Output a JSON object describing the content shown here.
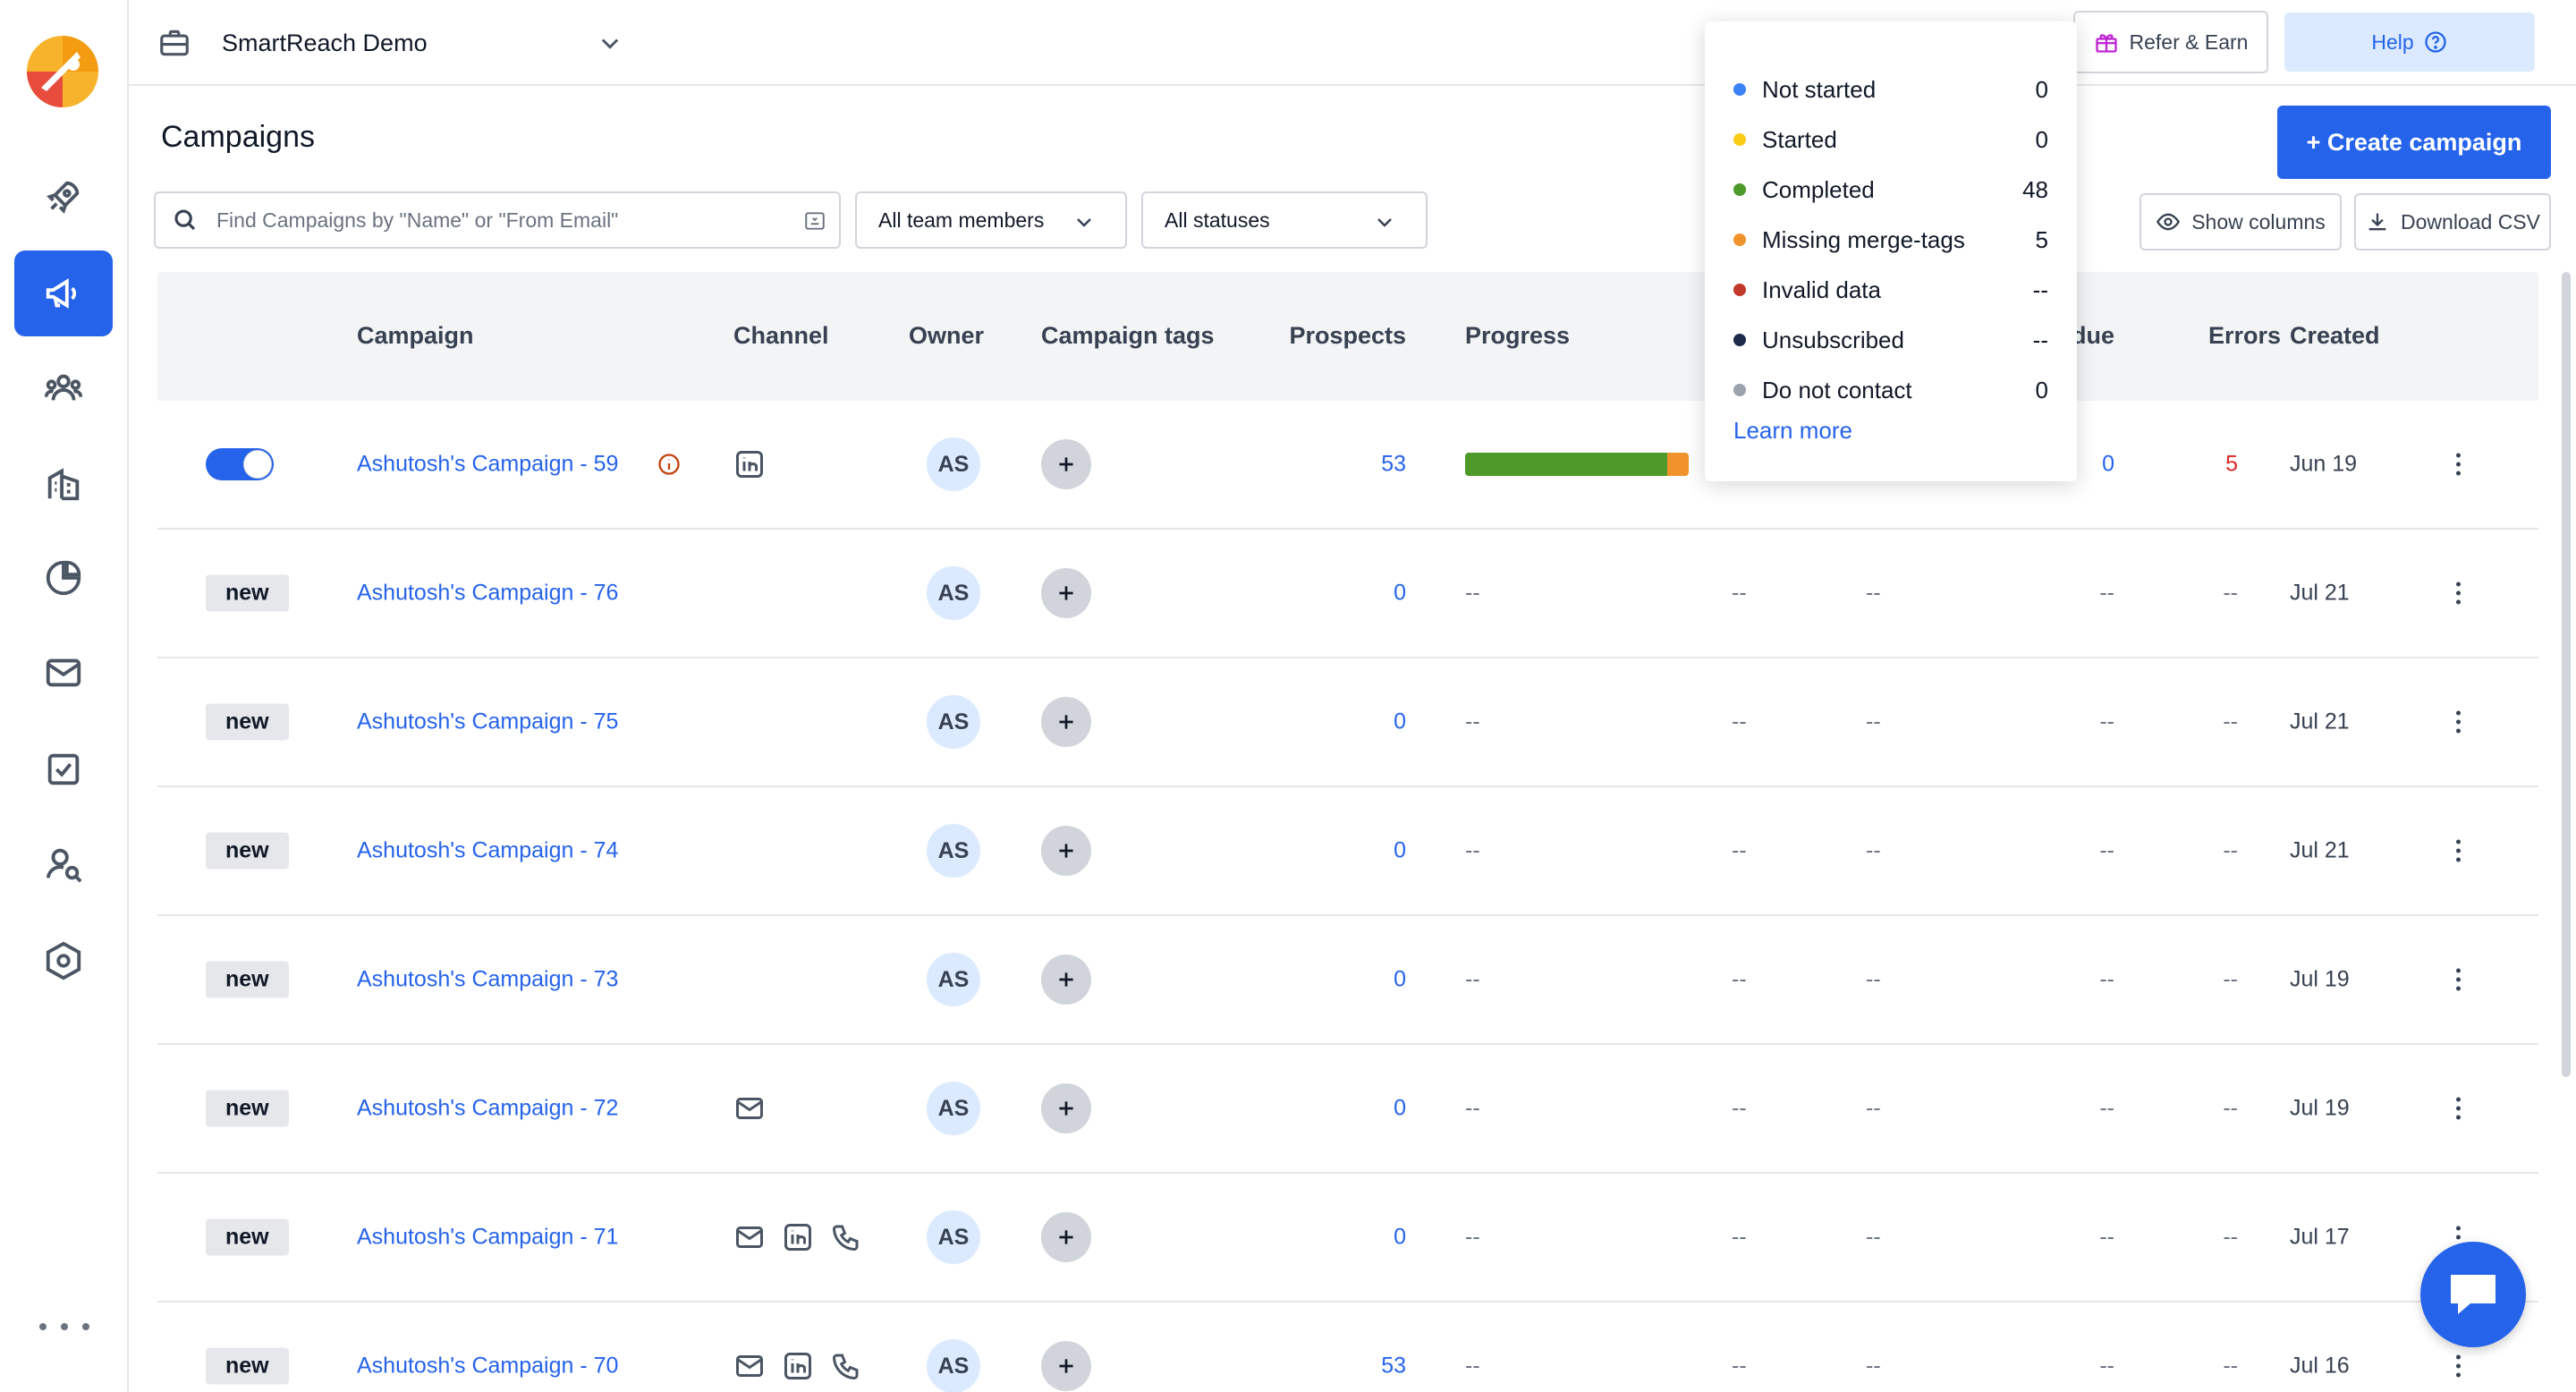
{
  "workspace": {
    "name": "SmartReach Demo"
  },
  "header": {
    "refer_label": "Refer & Earn",
    "help_label": "Help",
    "page_title": "Campaigns",
    "create_label": "+ Create campaign"
  },
  "filters": {
    "search_placeholder": "Find Campaigns by \"Name\" or \"From Email\"",
    "team_selected": "All team members",
    "status_selected": "All statuses",
    "show_columns_label": "Show columns",
    "download_label": "Download CSV"
  },
  "table": {
    "columns": {
      "campaign": "Campaign",
      "channel": "Channel",
      "owner": "Owner",
      "tags": "Campaign tags",
      "prospects": "Prospects",
      "progress": "Progress",
      "due": "due",
      "errors": "Errors",
      "created": "Created"
    },
    "rows": [
      {
        "status": "active",
        "badge": "",
        "name": "Ashutosh's Campaign - 59",
        "warning": true,
        "channels": [
          "linkedin-icon"
        ],
        "owner": "AS",
        "prospects": "53",
        "progress": {
          "completed": 48,
          "missing": 5
        },
        "progress_text": "",
        "col_a": "",
        "col_b": "",
        "due": "0",
        "errors": "5",
        "created": "Jun 19"
      },
      {
        "status": "new",
        "badge": "new",
        "name": "Ashutosh's Campaign - 76",
        "warning": false,
        "channels": [],
        "owner": "AS",
        "prospects": "0",
        "progress_text": "--",
        "col_a": "--",
        "col_b": "--",
        "due": "--",
        "errors": "--",
        "created": "Jul 21"
      },
      {
        "status": "new",
        "badge": "new",
        "name": "Ashutosh's Campaign - 75",
        "warning": false,
        "channels": [],
        "owner": "AS",
        "prospects": "0",
        "progress_text": "--",
        "col_a": "--",
        "col_b": "--",
        "due": "--",
        "errors": "--",
        "created": "Jul 21"
      },
      {
        "status": "new",
        "badge": "new",
        "name": "Ashutosh's Campaign - 74",
        "warning": false,
        "channels": [],
        "owner": "AS",
        "prospects": "0",
        "progress_text": "--",
        "col_a": "--",
        "col_b": "--",
        "due": "--",
        "errors": "--",
        "created": "Jul 21"
      },
      {
        "status": "new",
        "badge": "new",
        "name": "Ashutosh's Campaign - 73",
        "warning": false,
        "channels": [],
        "owner": "AS",
        "prospects": "0",
        "progress_text": "--",
        "col_a": "--",
        "col_b": "--",
        "due": "--",
        "errors": "--",
        "created": "Jul 19"
      },
      {
        "status": "new",
        "badge": "new",
        "name": "Ashutosh's Campaign - 72",
        "warning": false,
        "channels": [
          "email-icon"
        ],
        "owner": "AS",
        "prospects": "0",
        "progress_text": "--",
        "col_a": "--",
        "col_b": "--",
        "due": "--",
        "errors": "--",
        "created": "Jul 19"
      },
      {
        "status": "new",
        "badge": "new",
        "name": "Ashutosh's Campaign - 71",
        "warning": false,
        "channels": [
          "email-icon",
          "linkedin-icon",
          "phone-icon"
        ],
        "owner": "AS",
        "prospects": "0",
        "progress_text": "--",
        "col_a": "--",
        "col_b": "--",
        "due": "--",
        "errors": "--",
        "created": "Jul 17"
      },
      {
        "status": "new",
        "badge": "new",
        "name": "Ashutosh's Campaign - 70",
        "warning": false,
        "channels": [
          "email-icon",
          "linkedin-icon",
          "phone-icon"
        ],
        "owner": "AS",
        "prospects": "53",
        "progress_text": "--",
        "col_a": "--",
        "col_b": "--",
        "due": "--",
        "errors": "--",
        "created": "Jul 16"
      }
    ]
  },
  "progress_popover": {
    "items": [
      {
        "label": "Not started",
        "value": "0",
        "color": "#3b82f6"
      },
      {
        "label": "Started",
        "value": "0",
        "color": "#facc15"
      },
      {
        "label": "Completed",
        "value": "48",
        "color": "#4d9a2a"
      },
      {
        "label": "Missing merge-tags",
        "value": "5",
        "color": "#f0932b"
      },
      {
        "label": "Invalid data",
        "value": "--",
        "color": "#c0392b"
      },
      {
        "label": "Unsubscribed",
        "value": "--",
        "color": "#1e2a4a"
      },
      {
        "label": "Do not contact",
        "value": "0",
        "color": "#9ca3af"
      }
    ],
    "learn_more": "Learn more"
  },
  "sidebar": {
    "items": [
      "rocket-icon",
      "megaphone-icon",
      "users-icon",
      "building-icon",
      "pie-chart-icon",
      "mail-icon",
      "task-icon",
      "user-search-icon",
      "settings-hex-icon"
    ],
    "active": "megaphone-icon"
  }
}
